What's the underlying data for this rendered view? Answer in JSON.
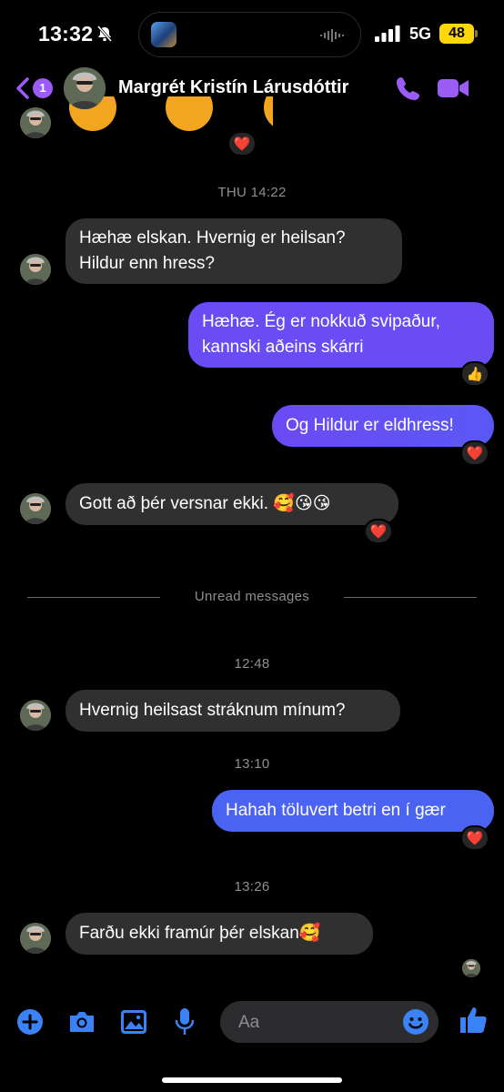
{
  "status_bar": {
    "time": "13:32",
    "network": "5G",
    "battery": "48"
  },
  "header": {
    "back_badge": "1",
    "contact_name": "Margrét Kristín Lárusdóttir",
    "icons": [
      "back-chevron-icon",
      "phone-icon",
      "video-camera-icon"
    ]
  },
  "colors": {
    "accent": "#9b5cf6",
    "outgoing_bubble": "#6a4cf5",
    "outgoing_bubble_late": "#4a63f2",
    "incoming_bubble": "#303030"
  },
  "top_reaction": "❤️",
  "messages": [
    {
      "type": "timestamp",
      "text": "THU 14:22"
    },
    {
      "type": "in",
      "lines": [
        "Hæhæ elskan. Hvernig er heilsan?",
        "Hildur enn hress?"
      ]
    },
    {
      "type": "out",
      "lines": [
        "Hæhæ. Ég er nokkuð svipaður,",
        "kannski aðeins skárri"
      ],
      "reaction": "👍"
    },
    {
      "type": "out",
      "text": "Og Hildur er eldhress!",
      "reaction": "❤️"
    },
    {
      "type": "in",
      "text": "Gott að þér versnar ekki. 🥰😘😘",
      "reaction": "❤️"
    },
    {
      "type": "divider",
      "text": "Unread messages"
    },
    {
      "type": "timestamp",
      "text": "12:48"
    },
    {
      "type": "in",
      "text": "Hvernig heilsast stráknum mínum?"
    },
    {
      "type": "timestamp",
      "text": "13:10"
    },
    {
      "type": "out",
      "text": "Hahah töluvert betri en í gær",
      "reaction": "❤️"
    },
    {
      "type": "timestamp",
      "text": "13:26"
    },
    {
      "type": "in",
      "text": "Farðu ekki framúr þér elskan🥰"
    }
  ],
  "composer": {
    "placeholder": "Aa",
    "icons": [
      "plus-icon",
      "camera-icon",
      "image-icon",
      "microphone-icon",
      "emoji-icon",
      "thumbs-up-icon"
    ]
  }
}
